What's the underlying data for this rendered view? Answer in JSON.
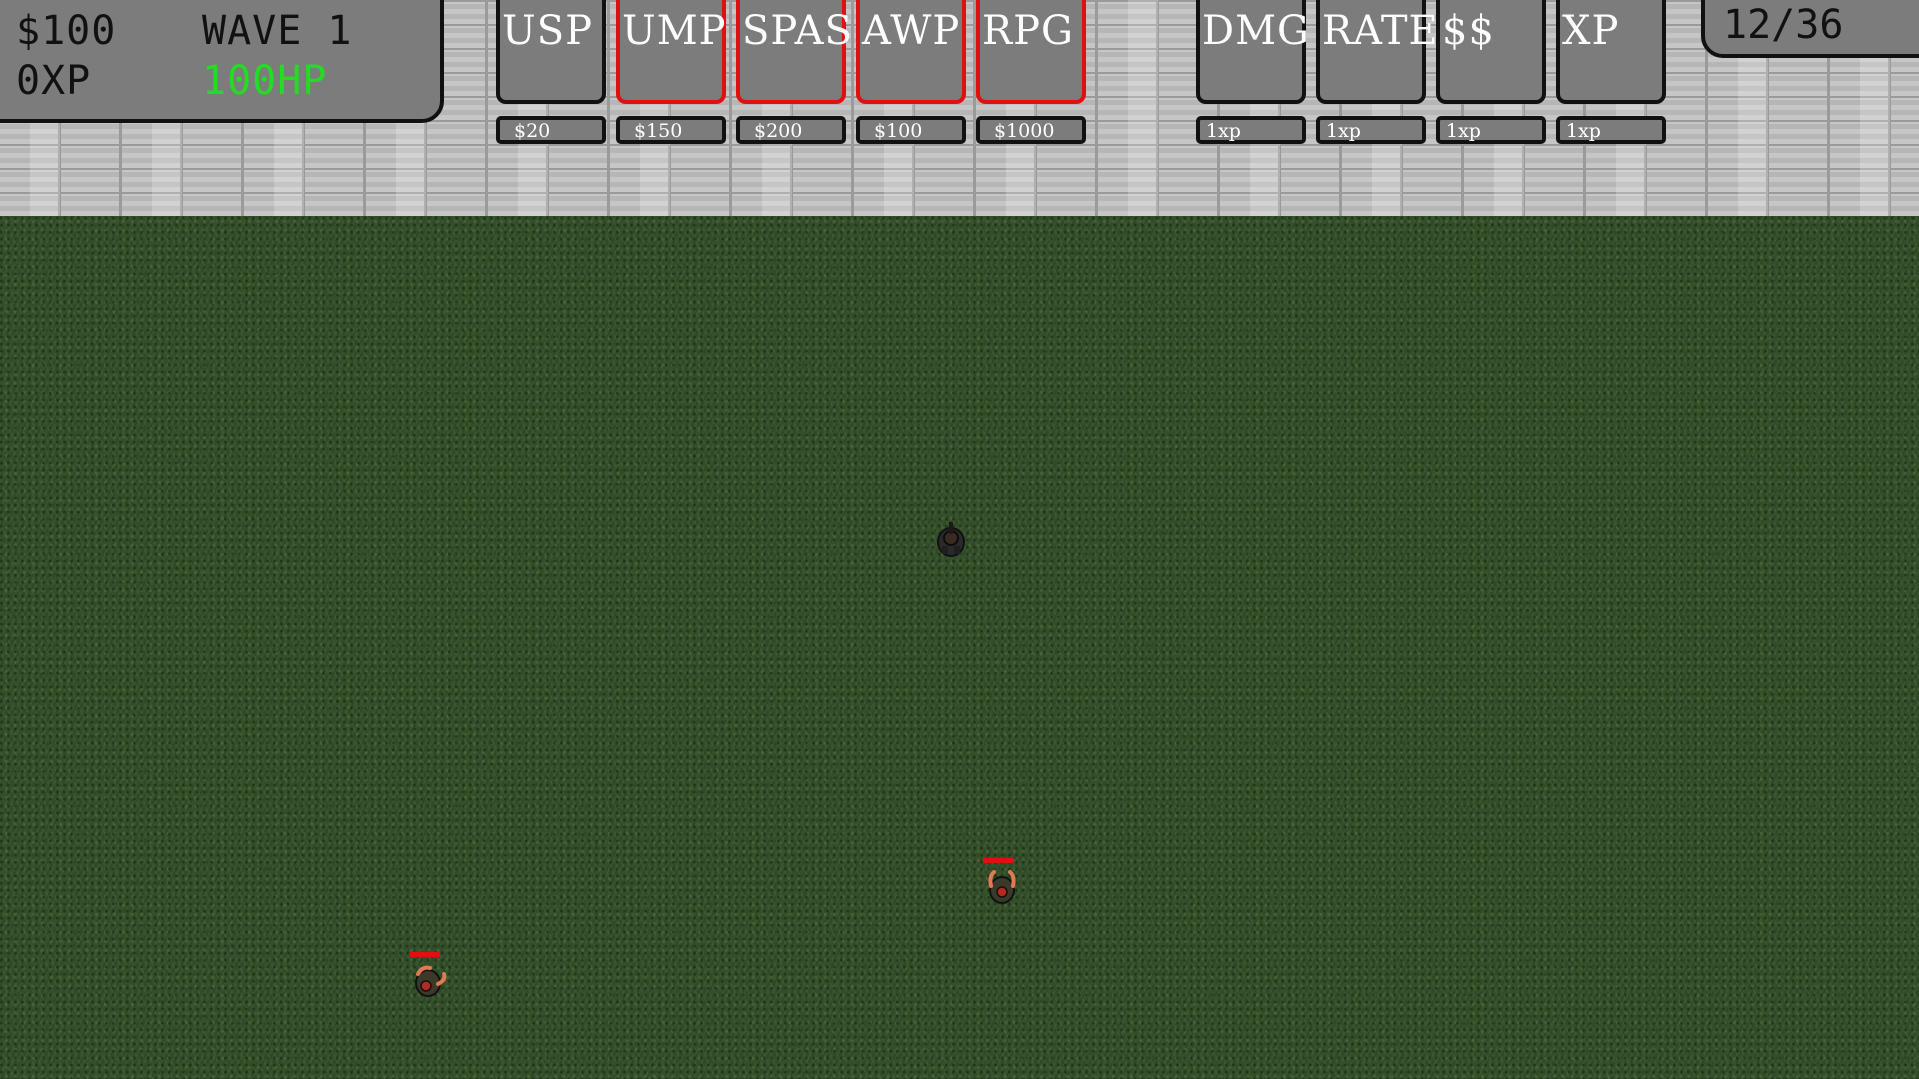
{
  "hud": {
    "money": "$100",
    "wave": "WAVE 1",
    "xp": "0XP",
    "hp": "100HP",
    "ammo": "12/36"
  },
  "weapons": [
    {
      "label": "USP",
      "price": "$20",
      "locked": false
    },
    {
      "label": "UMP",
      "price": "$150",
      "locked": true
    },
    {
      "label": "SPAS",
      "price": "$200",
      "locked": true
    },
    {
      "label": "AWP",
      "price": "$100",
      "locked": true
    },
    {
      "label": "RPG",
      "price": "$1000",
      "locked": true
    }
  ],
  "upgrades": [
    {
      "label": "DMG",
      "cost": "1xp"
    },
    {
      "label": "RATE",
      "cost": "1xp"
    },
    {
      "label": "$$",
      "cost": "1xp"
    },
    {
      "label": "XP",
      "cost": "1xp"
    }
  ],
  "colors": {
    "hp_text": "#22dd22",
    "locked_border": "#e01010",
    "panel": "#7c7c7c",
    "enemy_health": "#e01010"
  },
  "entities": {
    "player": "player-soldier",
    "enemies": [
      "zombie",
      "zombie"
    ]
  }
}
